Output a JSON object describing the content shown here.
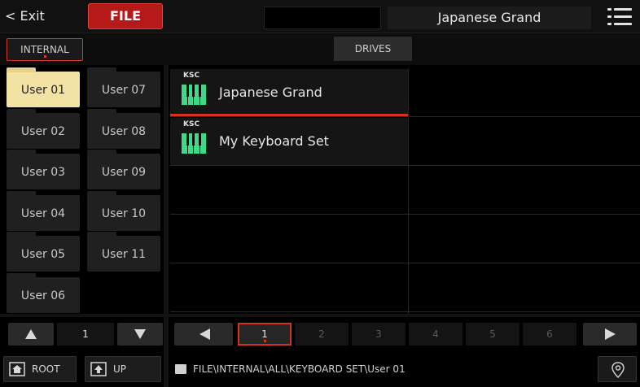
{
  "topbar": {
    "exit_label": "< Exit",
    "file_label": "FILE",
    "title": "Japanese Grand"
  },
  "tabs": {
    "internal_label": "INTERNAL",
    "drives_label": "DRIVES"
  },
  "folders": [
    {
      "label": "User 01",
      "selected": true
    },
    {
      "label": "User 02"
    },
    {
      "label": "User 03"
    },
    {
      "label": "User 04"
    },
    {
      "label": "User 05"
    },
    {
      "label": "User 06"
    },
    {
      "label": "User 07"
    },
    {
      "label": "User 08"
    },
    {
      "label": "User 09"
    },
    {
      "label": "User 10"
    },
    {
      "label": "User 11"
    }
  ],
  "files": [
    {
      "type_label": "KSC",
      "name": "Japanese Grand",
      "selected": true
    },
    {
      "type_label": "KSC",
      "name": "My Keyboard Set"
    }
  ],
  "user_page": "1",
  "pager": {
    "pages": [
      "1",
      "2",
      "3",
      "4",
      "5",
      "6"
    ],
    "current": "1"
  },
  "nav": {
    "root_label": "ROOT",
    "up_label": "UP"
  },
  "path": "FILE\\INTERNAL\\ALL\\KEYBOARD SET\\User 01",
  "colors": {
    "accent": "#d6331f",
    "file_tab": "#b5191a",
    "selected_folder": "#f2e2a4",
    "ksc_icon": "#3fd98a"
  }
}
